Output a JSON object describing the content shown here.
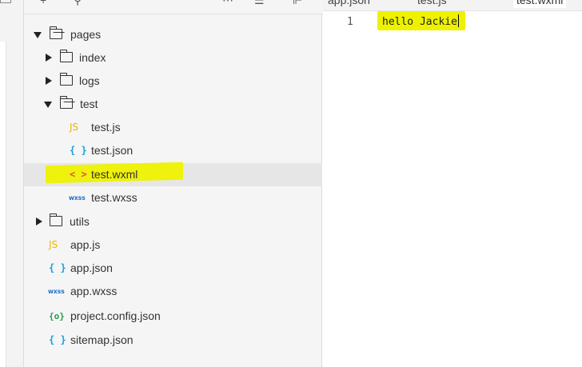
{
  "tabs": [
    {
      "label": "app.json",
      "active": false
    },
    {
      "label": "test.js",
      "active": false
    },
    {
      "label": "test.wxml",
      "active": true
    }
  ],
  "toolbar": {
    "icons": [
      "plus-icon",
      "search-icon",
      "more-icon",
      "collapse-icon",
      "split-icon"
    ]
  },
  "tree": {
    "items": [
      {
        "label": "pages",
        "type": "folder",
        "expanded": true,
        "depth": 0
      },
      {
        "label": "index",
        "type": "folder",
        "expanded": false,
        "depth": 1
      },
      {
        "label": "logs",
        "type": "folder",
        "expanded": false,
        "depth": 1
      },
      {
        "label": "test",
        "type": "folder",
        "expanded": true,
        "depth": 1
      },
      {
        "label": "test.js",
        "type": "file",
        "icon": "JS",
        "depth": 2
      },
      {
        "label": "test.json",
        "type": "file",
        "icon": "{ }",
        "depth": 2
      },
      {
        "label": "test.wxml",
        "type": "file",
        "icon": "< >",
        "depth": 2,
        "selected": true
      },
      {
        "label": "test.wxss",
        "type": "file",
        "icon": "wxss",
        "depth": 2
      },
      {
        "label": "utils",
        "type": "folder",
        "expanded": false,
        "depth": 0
      },
      {
        "label": "app.js",
        "type": "file",
        "icon": "JS",
        "depth": 0
      },
      {
        "label": "app.json",
        "type": "file",
        "icon": "{ }",
        "depth": 0
      },
      {
        "label": "app.wxss",
        "type": "file",
        "icon": "wxss",
        "depth": 0
      },
      {
        "label": "project.config.json",
        "type": "file",
        "icon": "{o}",
        "depth": 0
      },
      {
        "label": "sitemap.json",
        "type": "file",
        "icon": "{ }",
        "depth": 0
      }
    ]
  },
  "editor": {
    "line_number": "1",
    "code": "hello Jackie"
  },
  "colors": {
    "highlight": "#eef200",
    "js_icon": "#f0b400",
    "json_icon": "#1a9fd9",
    "wxml_icon": "#e74c3c",
    "wxss_icon": "#1a6fc4",
    "config_icon": "#2a9a4a"
  }
}
